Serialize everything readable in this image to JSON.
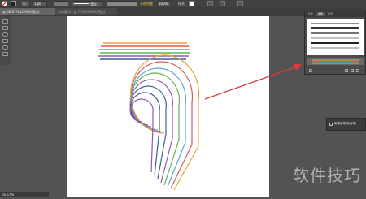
{
  "control_bar": {
    "stroke_label": "描边",
    "stroke_weight": "1 pt",
    "stroke_profile_label": "等比",
    "opacity_label": "不透明度",
    "opacity_value": "100%",
    "style_label": "样式"
  },
  "tabs": [
    {
      "label": "@ 66.67% (CMYK/预览)"
    },
    {
      "label": "未标题-1* @ 75% (CMYK/预览)"
    }
  ],
  "panel": {
    "tabs": [
      "色板",
      "画笔",
      "符号"
    ],
    "brush_colors": [
      "#3d6fb5",
      "#e0a030",
      "#d85050",
      "#6aab4a",
      "#8a5cb0",
      "#4aa8c8"
    ]
  },
  "tooltip": {
    "text": "新建画笔(新画笔)"
  },
  "status": {
    "zoom": "66.67%"
  },
  "watermark": "软件技巧",
  "colors": {
    "arrow": "#e23a3a",
    "app_bg": "#535353",
    "line_colors": [
      "#e8a23a",
      "#d95b5b",
      "#5aa7d8",
      "#66b04c",
      "#8a5cb6",
      "#3e5f99"
    ]
  }
}
